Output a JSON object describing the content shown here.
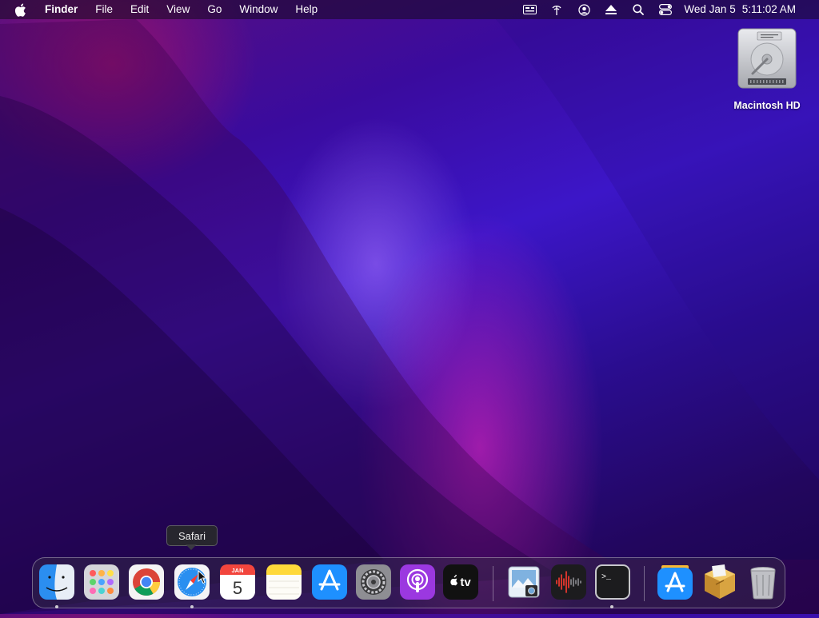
{
  "menubar": {
    "app_name": "Finder",
    "menus": [
      "File",
      "Edit",
      "View",
      "Go",
      "Window",
      "Help"
    ],
    "status_icons": [
      "display-icon",
      "wifi-icon",
      "user-icon",
      "eject-icon",
      "spotlight-search-icon",
      "control-center-icon"
    ],
    "clock": {
      "date": "Wed Jan 5",
      "time": "5:11:02 AM"
    }
  },
  "desktop": {
    "items": [
      {
        "label": "Macintosh HD",
        "icon": "hard-drive-icon"
      }
    ]
  },
  "tooltip": {
    "label": "Safari"
  },
  "calendar_icon": {
    "month": "JAN",
    "day": "5"
  },
  "appletv_icon": {
    "label": "tv"
  },
  "dock": {
    "apps": [
      {
        "name": "Finder",
        "icon": "finder-icon",
        "running": true
      },
      {
        "name": "Launchpad",
        "icon": "launchpad-icon",
        "running": false
      },
      {
        "name": "Google Chrome",
        "icon": "chrome-icon",
        "running": false
      },
      {
        "name": "Safari",
        "icon": "safari-icon",
        "running": true
      },
      {
        "name": "Calendar",
        "icon": "calendar-icon",
        "running": false
      },
      {
        "name": "Notes",
        "icon": "notes-icon",
        "running": false
      },
      {
        "name": "App Store",
        "icon": "app-store-icon",
        "running": false
      },
      {
        "name": "System Preferences",
        "icon": "system-preferences-icon",
        "running": false
      },
      {
        "name": "Podcasts",
        "icon": "podcasts-icon",
        "running": false
      },
      {
        "name": "Apple TV",
        "icon": "apple-tv-icon",
        "running": false
      },
      {
        "name": "Preview",
        "icon": "preview-icon",
        "running": false
      },
      {
        "name": "Voice Memos",
        "icon": "voice-memos-icon",
        "running": false
      },
      {
        "name": "Terminal",
        "icon": "terminal-icon",
        "running": true
      },
      {
        "name": "App Store Downloads",
        "icon": "app-store-downloads-icon",
        "running": false
      },
      {
        "name": "Installer",
        "icon": "installer-package-icon",
        "running": false
      },
      {
        "name": "Trash",
        "icon": "trash-icon",
        "running": false
      }
    ]
  },
  "colors": {
    "menubar_bg": "#1a0a24",
    "wallpaper_primary": "#3c16c8",
    "wallpaper_accent": "#ff28c8"
  }
}
